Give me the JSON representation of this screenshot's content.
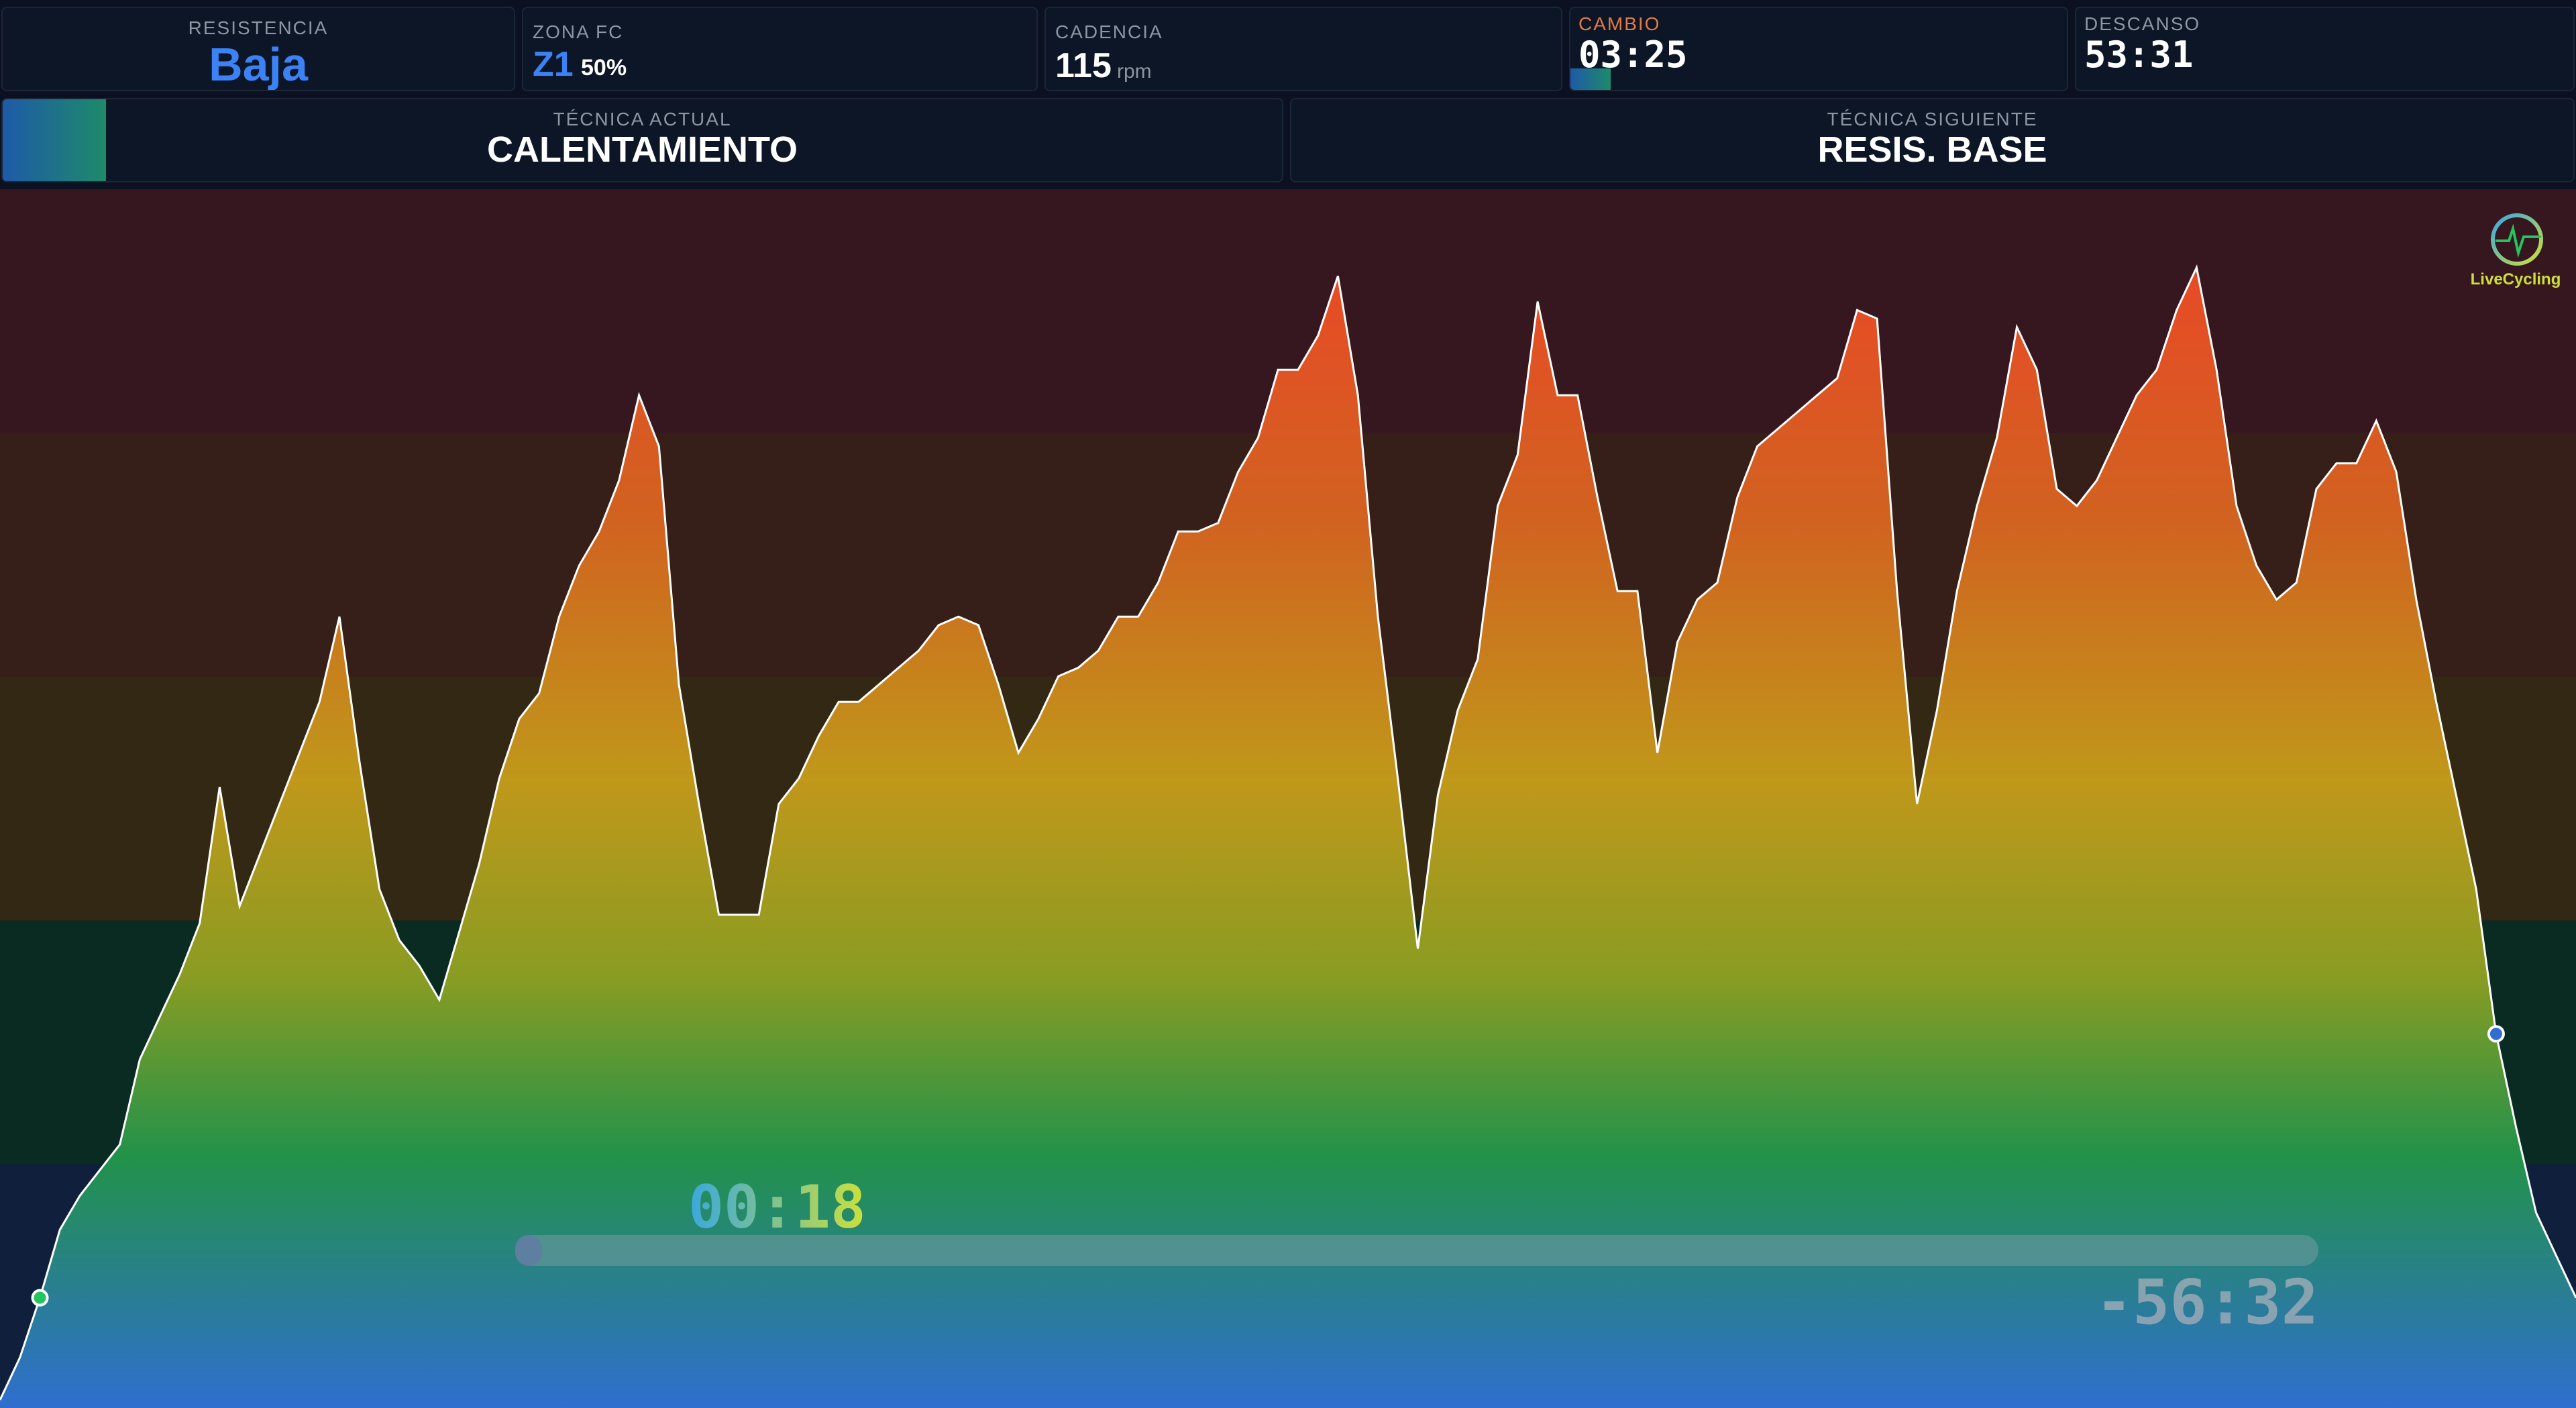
{
  "top_metrics": {
    "resistance": {
      "label": "RESISTENCIA",
      "value": "Baja"
    },
    "hr_zone": {
      "label": "ZONA FC",
      "zone": "Z1",
      "percent": "50%"
    },
    "cadence": {
      "label": "CADENCIA",
      "value": "115",
      "unit": "rpm"
    },
    "change": {
      "label": "CAMBIO",
      "value": "03:25"
    },
    "rest": {
      "label": "DESCANSO",
      "value": "53:31"
    }
  },
  "technique": {
    "current_label": "TÉCNICA ACTUAL",
    "current_value": "CALENTAMIENTO",
    "next_label": "TÉCNICA SIGUIENTE",
    "next_value": "RESIS. BASE"
  },
  "timer": {
    "elapsed": "00:18",
    "remaining": "-56:32",
    "progress": 0.01
  },
  "logo": {
    "text": "LiveCycling"
  },
  "colors": {
    "accent_blue": "#3b82f6",
    "change_orange": "#e27b43",
    "timer_green": "#cde03a",
    "timer_blue": "#3aa7e0"
  },
  "chart_data": {
    "type": "area",
    "zone_bands": [
      "#36171f",
      "#351f18",
      "#332814",
      "#0a2b22",
      "#0f1f3c"
    ],
    "profile": [
      0,
      5,
      12,
      20,
      24,
      27,
      30,
      40,
      45,
      50,
      56,
      72,
      58,
      64,
      70,
      76,
      82,
      92,
      75,
      60,
      54,
      51,
      47,
      55,
      63,
      73,
      80,
      83,
      92,
      98,
      102,
      108,
      118,
      112,
      84,
      70,
      57,
      57,
      57,
      70,
      73,
      78,
      82,
      82,
      84,
      86,
      88,
      91,
      92,
      91,
      84,
      76,
      80,
      85,
      86,
      88,
      92,
      92,
      96,
      102,
      102,
      103,
      109,
      113,
      121,
      121,
      125,
      132,
      118,
      92,
      73,
      53,
      71,
      81,
      87,
      105,
      111,
      129,
      118,
      118,
      106,
      95,
      95,
      76,
      89,
      94,
      96,
      106,
      112,
      114,
      116,
      118,
      120,
      128,
      127,
      95,
      70,
      81,
      95,
      105,
      113,
      126,
      121,
      107,
      105,
      108,
      113,
      118,
      121,
      128,
      133,
      121,
      105,
      98,
      94,
      96,
      107,
      110,
      110,
      115,
      109,
      94,
      82,
      71,
      60,
      43,
      32,
      22,
      17,
      12
    ]
  }
}
